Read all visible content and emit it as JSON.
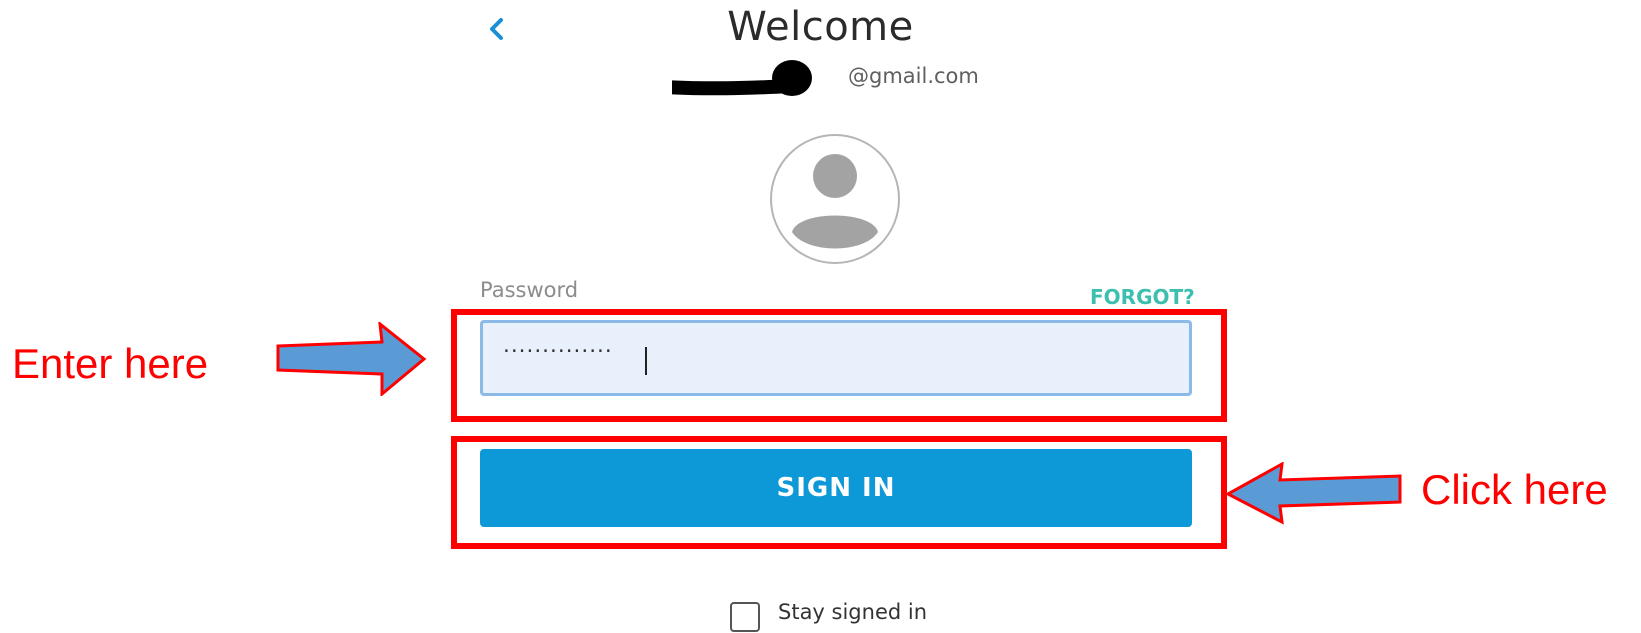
{
  "header": {
    "title": "Welcome",
    "email_visible": "@gmail.com",
    "back_icon": "chevron-left-icon"
  },
  "avatar": {
    "icon": "user-avatar-icon"
  },
  "password": {
    "label": "Password",
    "forgot_label": "FORGOT?",
    "masked_value": "··············"
  },
  "signin": {
    "label": "SIGN IN"
  },
  "stay_signed_in": {
    "label": "Stay signed in",
    "checked": false
  },
  "annotations": {
    "enter_label": "Enter here",
    "click_label": "Click here"
  },
  "colors": {
    "accent": "#0d98d8",
    "forgot": "#3cbfae",
    "input_bg": "#e8f0fc",
    "input_border": "#8bbae8",
    "annotation_red": "#ff0000",
    "arrow_blue": "#5b9bd5"
  }
}
